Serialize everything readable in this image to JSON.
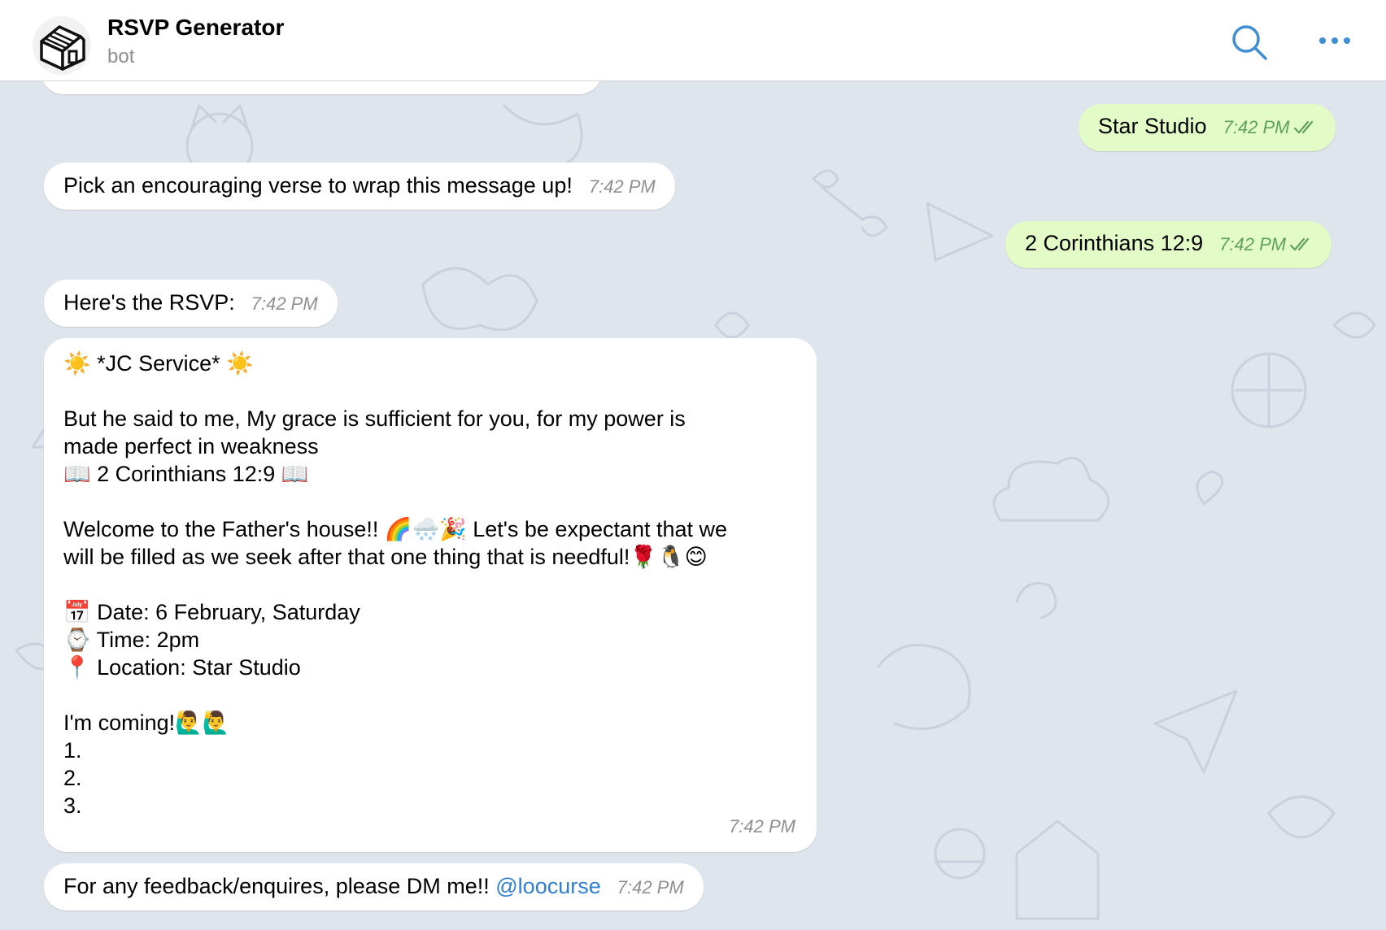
{
  "header": {
    "title": "RSVP Generator",
    "subtitle": "bot"
  },
  "colors": {
    "incoming_bubble": "#ffffff",
    "outgoing_bubble": "#e2fbc7",
    "chat_background": "#dfe5ec",
    "accent": "#3f8ed6",
    "link": "#2e7ed4"
  },
  "messages": [
    {
      "direction": "out",
      "text": "Star Studio",
      "time": "7:42 PM"
    },
    {
      "direction": "in",
      "text": "Pick an encouraging verse to wrap this message up!",
      "time": "7:42 PM"
    },
    {
      "direction": "out",
      "text": "2 Corinthians 12:9",
      "time": "7:42 PM"
    },
    {
      "direction": "in",
      "text": "Here's the RSVP:",
      "time": "7:42 PM"
    },
    {
      "direction": "in",
      "time": "7:42 PM",
      "rsvp": {
        "heading": "☀️ *JC Service* ☀️",
        "verse_line1": "But he said to me, My grace is sufficient for you, for my power is",
        "verse_line2": "made perfect in weakness",
        "verse_ref": "📖 2 Corinthians 12:9 📖",
        "welcome_line1": "Welcome to the Father's house!! 🌈🌨️🎉 Let's be expectant that we",
        "welcome_line2": "will be filled as we seek after that one thing that is needful!🌹🐧😊",
        "date": "📅 Date: 6 February, Saturday",
        "time_line": "⌚ Time: 2pm",
        "location": "📍 Location: Star Studio",
        "coming": "I'm coming!🙋‍♂️🙋‍♂️",
        "item1": "1.",
        "item2": "2.",
        "item3": "3."
      }
    },
    {
      "direction": "in",
      "text": "For any feedback/enquires, please DM me!! ",
      "link": "@loocurse",
      "time": "7:42 PM"
    }
  ]
}
